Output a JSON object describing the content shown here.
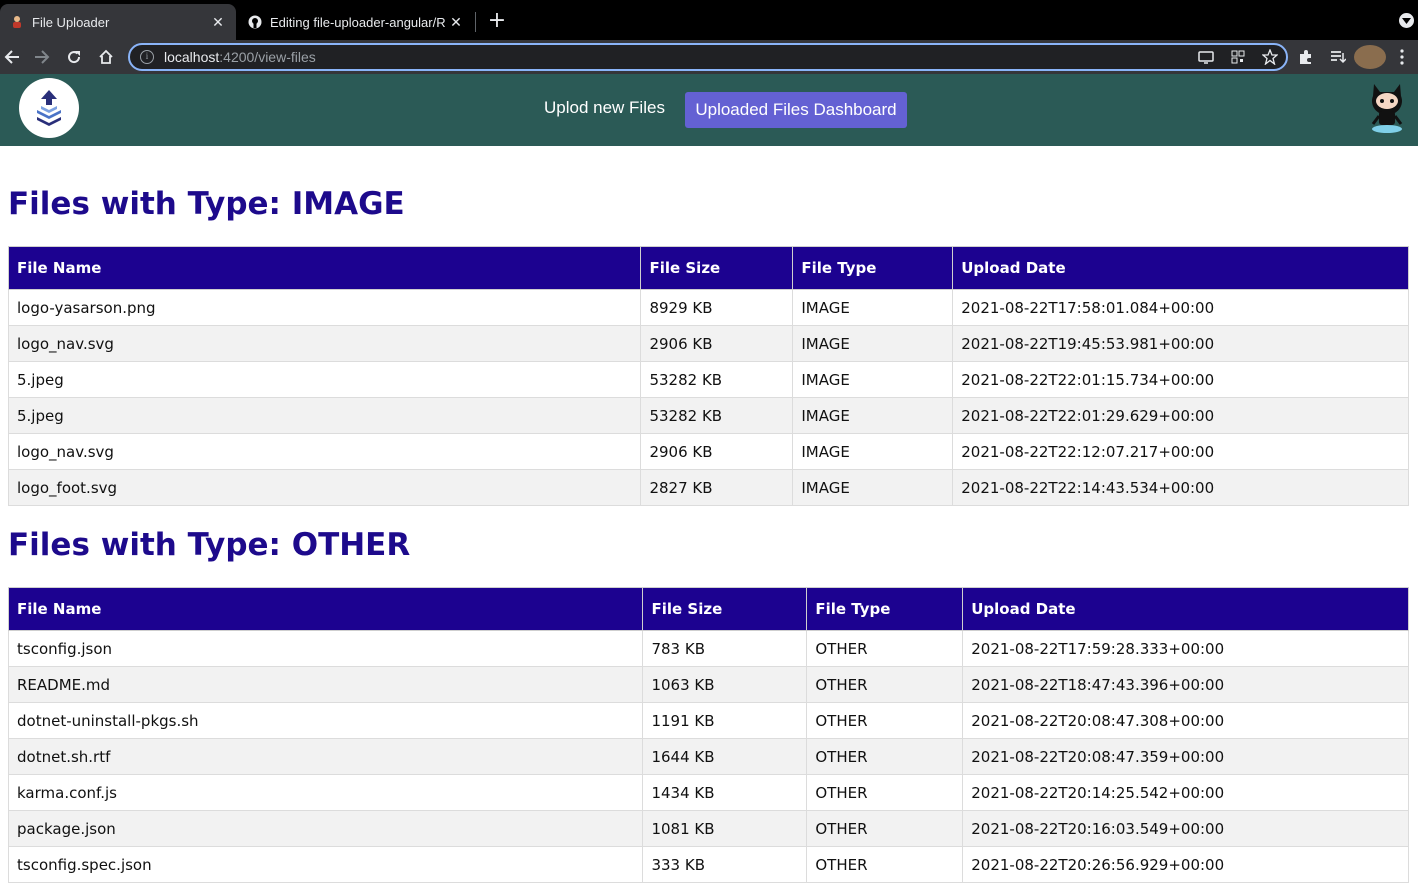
{
  "browser": {
    "tabs": [
      {
        "title": "File Uploader",
        "active": true
      },
      {
        "title": "Editing file-uploader-angular/R",
        "active": false
      }
    ],
    "url_host": "localhost",
    "url_path": ":4200/view-files"
  },
  "header": {
    "nav_upload": "Uplod new Files",
    "nav_dashboard": "Uploaded Files Dashboard"
  },
  "columns": [
    "File Name",
    "File Size",
    "File Type",
    "Upload Date"
  ],
  "sections": [
    {
      "title": "Files with Type: IMAGE",
      "rows": [
        [
          "logo-yasarson.png",
          "8929 KB",
          "IMAGE",
          "2021-08-22T17:58:01.084+00:00"
        ],
        [
          "logo_nav.svg",
          "2906 KB",
          "IMAGE",
          "2021-08-22T19:45:53.981+00:00"
        ],
        [
          "5.jpeg",
          "53282 KB",
          "IMAGE",
          "2021-08-22T22:01:15.734+00:00"
        ],
        [
          "5.jpeg",
          "53282 KB",
          "IMAGE",
          "2021-08-22T22:01:29.629+00:00"
        ],
        [
          "logo_nav.svg",
          "2906 KB",
          "IMAGE",
          "2021-08-22T22:12:07.217+00:00"
        ],
        [
          "logo_foot.svg",
          "2827 KB",
          "IMAGE",
          "2021-08-22T22:14:43.534+00:00"
        ]
      ]
    },
    {
      "title": "Files with Type: OTHER",
      "rows": [
        [
          "tsconfig.json",
          "783 KB",
          "OTHER",
          "2021-08-22T17:59:28.333+00:00"
        ],
        [
          "README.md",
          "1063 KB",
          "OTHER",
          "2021-08-22T18:47:43.396+00:00"
        ],
        [
          "dotnet-uninstall-pkgs.sh",
          "1191 KB",
          "OTHER",
          "2021-08-22T20:08:47.308+00:00"
        ],
        [
          "dotnet.sh.rtf",
          "1644 KB",
          "OTHER",
          "2021-08-22T20:08:47.359+00:00"
        ],
        [
          "karma.conf.js",
          "1434 KB",
          "OTHER",
          "2021-08-22T20:14:25.542+00:00"
        ],
        [
          "package.json",
          "1081 KB",
          "OTHER",
          "2021-08-22T20:16:03.549+00:00"
        ],
        [
          "tsconfig.spec.json",
          "333 KB",
          "OTHER",
          "2021-08-22T20:26:56.929+00:00"
        ]
      ]
    }
  ]
}
